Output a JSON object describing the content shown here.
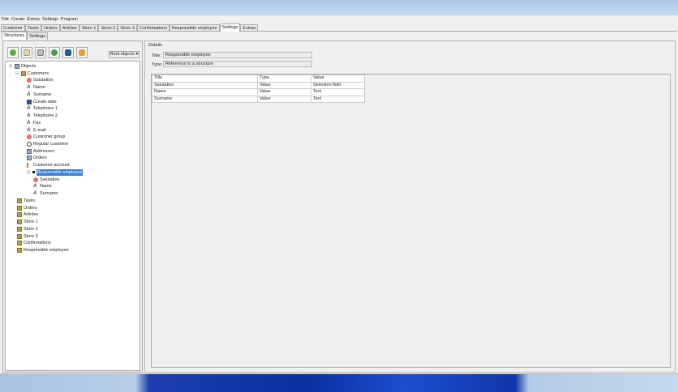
{
  "menu": [
    "File",
    "Create",
    "Extras",
    "Settings",
    "Program"
  ],
  "tabs": [
    "Customer",
    "Tasks",
    "Orders",
    "Articles",
    "Store 1",
    "Store 2",
    "Store 3",
    "Confirmations",
    "Responsible employee",
    "Settings",
    "Extras"
  ],
  "active_tab": "Settings",
  "subtabs": [
    "Structures",
    "Settings"
  ],
  "root_objects_label": "Root objects",
  "tree": [
    {
      "label": "Objects",
      "icon": "objects",
      "level": 0
    },
    {
      "label": "Customers",
      "icon": "folder",
      "level": 1
    },
    {
      "label": "Salutation",
      "icon": "dot",
      "level": 2
    },
    {
      "label": "Name",
      "icon": "text",
      "level": 2
    },
    {
      "label": "Surname",
      "icon": "text",
      "level": 2
    },
    {
      "label": "Create date",
      "icon": "calendar",
      "level": 2
    },
    {
      "label": "Telephone 1",
      "icon": "text",
      "level": 2
    },
    {
      "label": "Telephone 2",
      "icon": "text",
      "level": 2
    },
    {
      "label": "Fax",
      "icon": "text",
      "level": 2
    },
    {
      "label": "E-mail",
      "icon": "text",
      "level": 2
    },
    {
      "label": "Customer group",
      "icon": "dot",
      "level": 2
    },
    {
      "label": "Regular customer",
      "icon": "check",
      "level": 2
    },
    {
      "label": "Addresses",
      "icon": "grid",
      "level": 2
    },
    {
      "label": "Orders",
      "icon": "grid",
      "level": 2
    },
    {
      "label": "Customer account",
      "icon": "link",
      "level": 2
    },
    {
      "label": "Responsible employee",
      "icon": "struct",
      "level": 2,
      "selected": true
    },
    {
      "label": "Salutation",
      "icon": "dot",
      "level": 3
    },
    {
      "label": "Name",
      "icon": "text",
      "level": 3
    },
    {
      "label": "Surname",
      "icon": "text",
      "level": 3
    },
    {
      "label": "Tasks",
      "icon": "folder",
      "level": 1
    },
    {
      "label": "Orders",
      "icon": "folder",
      "level": 1
    },
    {
      "label": "Articles",
      "icon": "folder",
      "level": 1
    },
    {
      "label": "Store 1",
      "icon": "folder",
      "level": 1
    },
    {
      "label": "Store 2",
      "icon": "folder",
      "level": 1
    },
    {
      "label": "Store 3",
      "icon": "folder",
      "level": 1
    },
    {
      "label": "Confirmations",
      "icon": "folder",
      "level": 1
    },
    {
      "label": "Responsible employee",
      "icon": "folder",
      "level": 1
    }
  ],
  "details": {
    "legend": "Details",
    "title_label": "Title:",
    "title_value": "Responsible employee",
    "type_label": "Type:",
    "type_value": "Reference to a structure",
    "columns": [
      "Title",
      "Type",
      "Value"
    ],
    "rows": [
      [
        "Salutation",
        "Value",
        "Selection field"
      ],
      [
        "Name",
        "Value",
        "Text"
      ],
      [
        "Surname",
        "Value",
        "Text"
      ]
    ]
  }
}
